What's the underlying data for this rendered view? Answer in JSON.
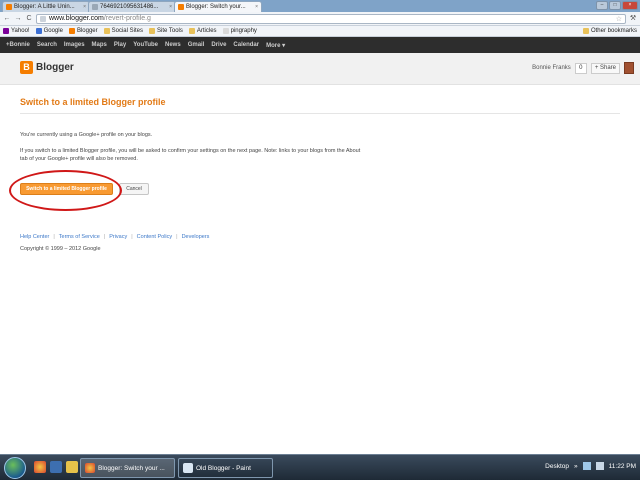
{
  "tabs": [
    {
      "title": "Blogger: A Little Unin...",
      "active": false
    },
    {
      "title": "7646921095631486...",
      "active": false
    },
    {
      "title": "Blogger: Switch your...",
      "active": true
    }
  ],
  "window_controls": {
    "minimize": "–",
    "maximize": "□",
    "close": "×"
  },
  "toolbar": {
    "back": "←",
    "forward": "→",
    "reload": "C",
    "url_host": "www.blogger.com",
    "url_path": "/revert-profile.g",
    "star": "☆",
    "wrench": "⚒"
  },
  "bookmarks": {
    "items": [
      "Yahoo!",
      "Google",
      "Blogger",
      "Social Sites",
      "Site Tools",
      "Articles",
      "pingraphy"
    ],
    "other": "Other bookmarks"
  },
  "google_bar": [
    "+Bonnie",
    "Search",
    "Images",
    "Maps",
    "Play",
    "YouTube",
    "News",
    "Gmail",
    "Drive",
    "Calendar",
    "More ▾"
  ],
  "blogger_header": {
    "logo_mark": "B",
    "logo_text": "Blogger",
    "user_name": "Bonnie Franks",
    "count": "0",
    "share_label": "+ Share"
  },
  "main": {
    "title": "Switch to a limited Blogger profile",
    "para1": "You're currently using a Google+ profile on your blogs.",
    "para2": "If you switch to a limited Blogger profile, you will be asked to confirm your settings on the next page. Note: links to your blogs from the About tab of your Google+ profile will also be removed.",
    "switch_button": "Switch to a limited Blogger profile",
    "cancel_button": "Cancel"
  },
  "footer": {
    "links": [
      "Help Center",
      "Terms of Service",
      "Privacy",
      "Content Policy",
      "Developers"
    ],
    "separator": "|",
    "copyright": "Copyright © 1999 – 2012 Google"
  },
  "taskbar": {
    "tasks": [
      {
        "label": "Blogger: Switch your ...",
        "active": true
      },
      {
        "label": "Old Blogger - Paint",
        "active": false
      }
    ],
    "desktop_label": "Desktop",
    "desktop_arrow": "»",
    "clock": "11:22 PM"
  },
  "colors": {
    "accent_orange": "#f89a32",
    "title_orange": "#e27a16",
    "link_blue": "#3c78c8",
    "annotation_red": "#d01818",
    "google_bar": "#2d2d2d"
  }
}
